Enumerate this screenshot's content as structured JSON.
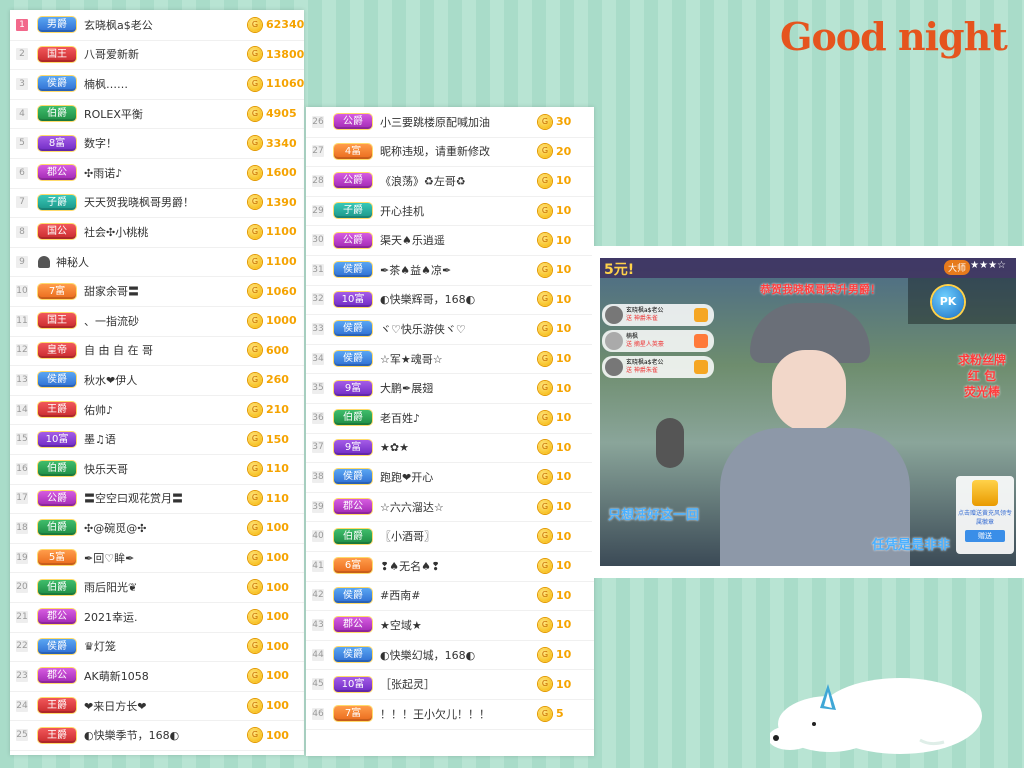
{
  "left_list": [
    {
      "rank": "1",
      "badge": "男爵",
      "color": "blue",
      "name": "玄晓枫a$老公",
      "score": "62340",
      "top": true
    },
    {
      "rank": "2",
      "badge": "国王",
      "color": "red",
      "name": "八哥爱新新",
      "score": "13800"
    },
    {
      "rank": "3",
      "badge": "侯爵",
      "color": "blue",
      "name": "楠枫……",
      "score": "11060"
    },
    {
      "rank": "4",
      "badge": "伯爵",
      "color": "green",
      "name": "ROLEX平衡",
      "score": "4905"
    },
    {
      "rank": "5",
      "badge": "8富",
      "color": "purple",
      "name": "数字！",
      "score": "3340"
    },
    {
      "rank": "6",
      "badge": "郡公",
      "color": "magenta",
      "name": "✣雨诺♪",
      "score": "1600"
    },
    {
      "rank": "7",
      "badge": "子爵",
      "color": "teal",
      "name": "天天贺我晓枫哥男爵！",
      "score": "1390"
    },
    {
      "rank": "8",
      "badge": "国公",
      "color": "red",
      "name": "社会✣小桃桃",
      "score": "1100"
    },
    {
      "rank": "9",
      "badge": "",
      "color": "",
      "name": "神秘人",
      "score": "1100",
      "mystery": true
    },
    {
      "rank": "10",
      "badge": "7富",
      "color": "orange",
      "name": "甜家余哥〓",
      "score": "1060"
    },
    {
      "rank": "11",
      "badge": "国王",
      "color": "red",
      "name": "、一指流砂",
      "score": "1000"
    },
    {
      "rank": "12",
      "badge": "皇帝",
      "color": "red",
      "name": "自 由 自 在 哥",
      "score": "600"
    },
    {
      "rank": "13",
      "badge": "侯爵",
      "color": "blue",
      "name": "秋水❤伊人",
      "score": "260"
    },
    {
      "rank": "14",
      "badge": "王爵",
      "color": "red",
      "name": "佑帅♪",
      "score": "210"
    },
    {
      "rank": "15",
      "badge": "10富",
      "color": "purple",
      "name": "墨♫语",
      "score": "150"
    },
    {
      "rank": "16",
      "badge": "伯爵",
      "color": "green",
      "name": "快乐天哥",
      "score": "110"
    },
    {
      "rank": "17",
      "badge": "公爵",
      "color": "magenta",
      "name": "〓空空曰观花赏月〓",
      "score": "110"
    },
    {
      "rank": "18",
      "badge": "伯爵",
      "color": "green",
      "name": "✣@碗觅@✣",
      "score": "100"
    },
    {
      "rank": "19",
      "badge": "5富",
      "color": "orange",
      "name": "✒回♡眸✒",
      "score": "100"
    },
    {
      "rank": "20",
      "badge": "伯爵",
      "color": "green",
      "name": "雨后阳光❦",
      "score": "100"
    },
    {
      "rank": "21",
      "badge": "郡公",
      "color": "magenta",
      "name": "2021幸运.",
      "score": "100"
    },
    {
      "rank": "22",
      "badge": "侯爵",
      "color": "blue",
      "name": "♛灯笼",
      "score": "100"
    },
    {
      "rank": "23",
      "badge": "郡公",
      "color": "magenta",
      "name": "AK萌新1058",
      "score": "100"
    },
    {
      "rank": "24",
      "badge": "王爵",
      "color": "red",
      "name": "❤来日方长❤",
      "score": "100"
    },
    {
      "rank": "25",
      "badge": "王爵",
      "color": "red",
      "name": "◐快樂季节，168◐",
      "score": "100"
    }
  ],
  "right_list": [
    {
      "rank": "26",
      "badge": "公爵",
      "color": "magenta",
      "name": "小三要跳楼原配喊加油",
      "score": "30"
    },
    {
      "rank": "27",
      "badge": "4富",
      "color": "orange",
      "name": "昵称违规，请重新修改",
      "score": "20"
    },
    {
      "rank": "28",
      "badge": "公爵",
      "color": "magenta",
      "name": "《浪荡》♻左哥♻",
      "score": "10"
    },
    {
      "rank": "29",
      "badge": "子爵",
      "color": "teal",
      "name": "开心挂机",
      "score": "10"
    },
    {
      "rank": "30",
      "badge": "公爵",
      "color": "magenta",
      "name": "渠天♠乐逍遥",
      "score": "10"
    },
    {
      "rank": "31",
      "badge": "侯爵",
      "color": "blue",
      "name": "✒茶♠益♠凉✒",
      "score": "10"
    },
    {
      "rank": "32",
      "badge": "10富",
      "color": "purple",
      "name": "◐快樂辉哥，168◐",
      "score": "10"
    },
    {
      "rank": "33",
      "badge": "侯爵",
      "color": "blue",
      "name": "ヾ♡快乐游侠ヾ♡",
      "score": "10"
    },
    {
      "rank": "34",
      "badge": "侯爵",
      "color": "blue",
      "name": "☆军★魂哥☆",
      "score": "10"
    },
    {
      "rank": "35",
      "badge": "9富",
      "color": "purple",
      "name": "大鹏✒展翅",
      "score": "10"
    },
    {
      "rank": "36",
      "badge": "伯爵",
      "color": "green",
      "name": "老百姓♪",
      "score": "10"
    },
    {
      "rank": "37",
      "badge": "9富",
      "color": "purple",
      "name": "★✿★",
      "score": "10"
    },
    {
      "rank": "38",
      "badge": "侯爵",
      "color": "blue",
      "name": "跑跑❤开心",
      "score": "10"
    },
    {
      "rank": "39",
      "badge": "郡公",
      "color": "magenta",
      "name": "☆六六溜达☆",
      "score": "10"
    },
    {
      "rank": "40",
      "badge": "伯爵",
      "color": "green",
      "name": "〖小酒哥〗",
      "score": "10"
    },
    {
      "rank": "41",
      "badge": "6富",
      "color": "orange",
      "name": "❢♠无名♠❢",
      "score": "10"
    },
    {
      "rank": "42",
      "badge": "侯爵",
      "color": "blue",
      "name": "#西南#",
      "score": "10"
    },
    {
      "rank": "43",
      "badge": "郡公",
      "color": "magenta",
      "name": "★空域★",
      "score": "10"
    },
    {
      "rank": "44",
      "badge": "侯爵",
      "color": "blue",
      "name": "◐快樂幻城，168◐",
      "score": "10"
    },
    {
      "rank": "45",
      "badge": "10富",
      "color": "purple",
      "name": "［张起灵］",
      "score": "10"
    },
    {
      "rank": "46",
      "badge": "7富",
      "color": "orange",
      "name": "！！！王小欠儿！！！",
      "score": "5"
    }
  ],
  "coin_symbol": "G",
  "decor": {
    "goodnight": "Good night"
  },
  "stream": {
    "price_text": "5元!",
    "banner": "恭贺我晓枫哥荣升男爵！",
    "side_text": [
      "求粉丝牌",
      "红 包",
      "荧光棒"
    ],
    "pk_label": "PK",
    "master_label": "大师",
    "caption_left": "只想活好这一回",
    "caption_right": "任凭是是非非",
    "gift_label": "赠送",
    "gift_tip": "点击赠送黄充风领专属徽章",
    "chat": [
      {
        "name": "玄晓枫a$老公",
        "desc": "送 神爵朱雀"
      },
      {
        "name": "楠枫",
        "desc": "送 摘星人英豪"
      },
      {
        "name": "玄晓枫a$老公",
        "desc": "送 神爵朱雀"
      }
    ]
  }
}
